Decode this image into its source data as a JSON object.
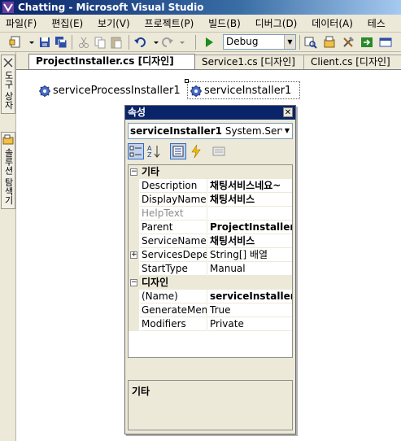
{
  "window": {
    "title": "Chatting - Microsoft Visual Studio"
  },
  "menu": [
    "파일(F)",
    "편집(E)",
    "보기(V)",
    "프로젝트(P)",
    "빌드(B)",
    "디버그(D)",
    "데이터(A)",
    "테스"
  ],
  "toolbar": {
    "config_value": "Debug"
  },
  "sidebar": {
    "toolbox_label": "도구 상자",
    "solution_explorer_label": "솔루션 탐색기"
  },
  "tabs": [
    "ProjectInstaller.cs [디자인]",
    "Service1.cs [디자인]",
    "Client.cs [디자인]"
  ],
  "designer": {
    "components": [
      "serviceProcessInstaller1",
      "serviceInstaller1"
    ]
  },
  "properties": {
    "title": "속성",
    "object_name": "serviceInstaller1",
    "object_type": "System.Serv",
    "categories": [
      {
        "name": "기타",
        "rows": [
          {
            "name": "Description",
            "value": "채팅서비스네요~"
          },
          {
            "name": "DisplayName",
            "value": "채팅서비스"
          },
          {
            "name": "HelpText",
            "value": ""
          },
          {
            "name": "Parent",
            "value": "ProjectInstaller"
          },
          {
            "name": "ServiceName",
            "value": "채팅서비스"
          },
          {
            "name": "ServicesDeper",
            "value": "String[] 배열"
          },
          {
            "name": "StartType",
            "value": "Manual"
          }
        ]
      },
      {
        "name": "디자인",
        "rows": [
          {
            "name": "(Name)",
            "value": "serviceInstaller"
          },
          {
            "name": "GenerateMem",
            "value": "True"
          },
          {
            "name": "Modifiers",
            "value": "Private"
          }
        ]
      }
    ],
    "description_title": "기타"
  }
}
